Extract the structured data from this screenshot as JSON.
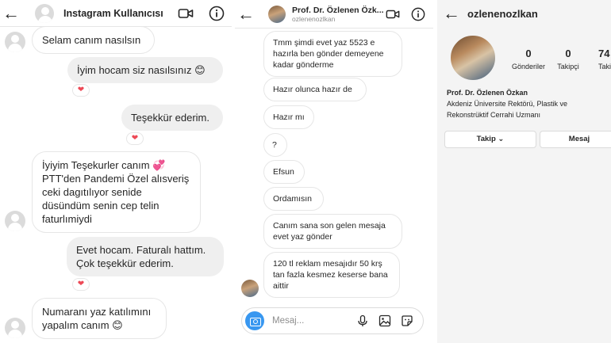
{
  "panel1": {
    "title": "Instagram Kullanıcısı",
    "messages": [
      {
        "dir": "in",
        "text": "Selam canım nasılsın"
      },
      {
        "dir": "out",
        "text": "İyim hocam siz nasılsınız 😊"
      },
      {
        "dir": "out",
        "text": "Teşekkür ederim."
      },
      {
        "dir": "in",
        "text": "İyiyim Teşekurler canım 💞 PTT'den Pandemi  Özel alısveriş ceki dagıtılıyor senide düsündüm senin cep telin faturlımiydi"
      },
      {
        "dir": "out",
        "text": "Evet hocam. Faturalı hattım. Çok teşekkür ederim."
      },
      {
        "dir": "in",
        "text": "Numaranı yaz katılımını yapalım canım 😊"
      }
    ],
    "heart": "❤"
  },
  "panel2": {
    "title": "Prof. Dr. Özlenen Özk...",
    "subtitle": "ozlenenozlkan",
    "messages": [
      "Tmm şimdi evet yaz 5523 e hazırla ben gönder demeyene kadar gönderme",
      "Hazır olunca hazır de",
      "Hazır mı",
      "?",
      "Efsun",
      "Ordamısın",
      "Canım sana son gelen mesaja evet yaz gönder",
      "120 tl reklam mesajıdır 50 krş tan fazla kesmez keserse bana aittir"
    ],
    "composer_placeholder": "Mesaj..."
  },
  "panel3": {
    "username": "ozlenenozlkan",
    "stats": [
      {
        "num": "0",
        "label": "Gönderiler"
      },
      {
        "num": "0",
        "label": "Takipçi"
      },
      {
        "num": "74",
        "label": "Takip"
      }
    ],
    "name": "Prof. Dr. Özlenen Özkan",
    "bio": "Akdeniz Üniversite Rektörü, Plastik ve Rekonstrüktif Cerrahi Uzmanı",
    "follow_label": "Takip ⌄",
    "message_label": "Mesaj"
  }
}
